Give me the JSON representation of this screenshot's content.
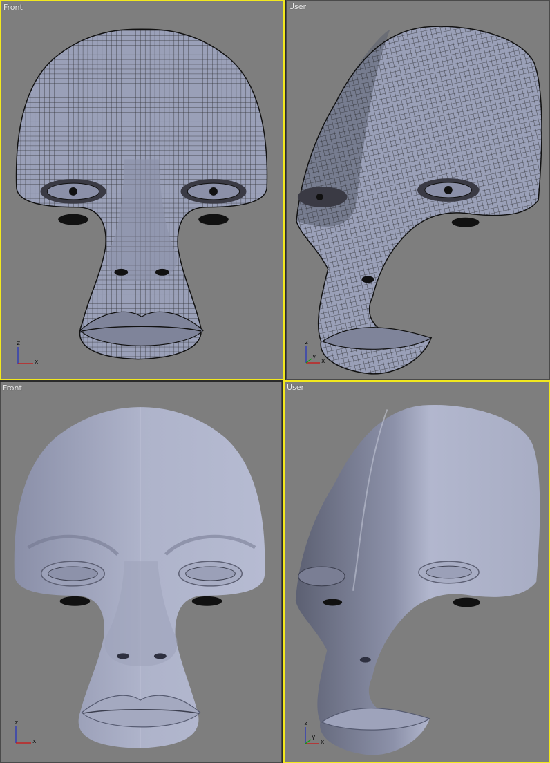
{
  "viewports": [
    {
      "label": "Front",
      "mode": "wireframe",
      "active": true
    },
    {
      "label": "User",
      "mode": "wireframe",
      "active": false
    },
    {
      "label": "Front",
      "mode": "shaded",
      "active": false
    },
    {
      "label": "User",
      "mode": "shaded",
      "active": true
    }
  ],
  "axis": {
    "z": "z",
    "x": "x",
    "y": "y"
  },
  "colors": {
    "viewport_bg": "#7e7e7e",
    "active_border": "#f2e81e",
    "mesh_fill": "#9aa0b8",
    "wire": "#1c1c1c",
    "axis_x": "#d01010",
    "axis_z": "#2030c0",
    "axis_y": "#10a010"
  }
}
